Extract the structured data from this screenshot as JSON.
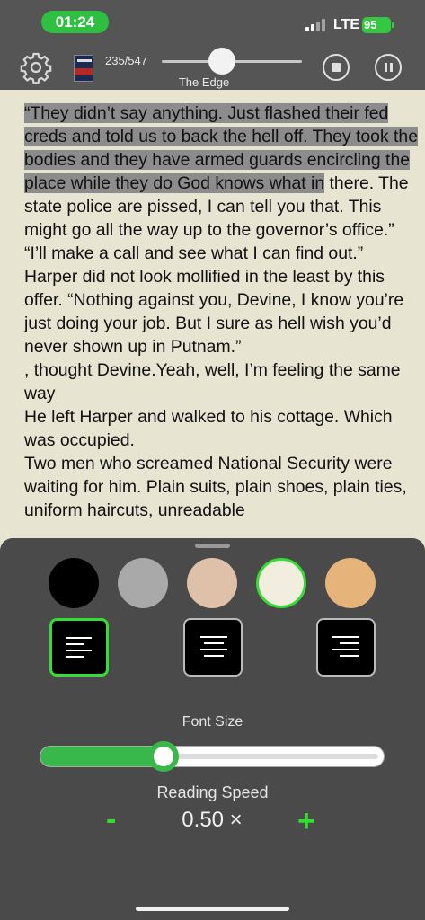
{
  "status_bar": {
    "time": "01:24",
    "network": "LTE",
    "battery": "95"
  },
  "player": {
    "page_indicator": "235/547",
    "book_title": "The Edge",
    "progress_fraction": 0.43
  },
  "reading": {
    "paragraphs": [
      {
        "highlighted": "“They didn’t say anything. Just flashed their fed creds and told us to back the hell off. They took the bodies and they have armed guards encircling the place while they do God knows what in",
        "text": " there. The state police are pissed, I can tell you that. This might go all the way up to the governor’s office.”"
      },
      {
        "text": "“I’ll make a call and see what I can find out.”"
      },
      {
        "text": "Harper did not look mollified in the least by this offer. “Nothing against you, Devine, I know you’re just doing your job. But I sure as hell wish you’d never shown up in Putnam.”"
      },
      {
        "text": ", thought Devine.Yeah, well, I’m feeling the same way"
      },
      {
        "text": "He left Harper and walked to his cottage. Which was occupied."
      },
      {
        "text": "Two men who screamed National Security were waiting for him. Plain suits, plain shoes, plain ties, uniform haircuts, unreadable"
      }
    ]
  },
  "settings": {
    "colors": [
      "#000000",
      "#a9a9a9",
      "#dfc0a9",
      "#f2eedf",
      "#e6b47a"
    ],
    "selected_color_index": 3,
    "selected_align": "left",
    "font_size_label": "Font Size",
    "font_size_fraction": 0.36,
    "reading_speed_label": "Reading Speed",
    "speed_minus": "-",
    "speed_value": "0.50 ×",
    "speed_plus": "+"
  },
  "colors": {
    "accent": "#33dd33",
    "slider_fill": "#38b84a",
    "highlight": "#8c8c8c"
  }
}
